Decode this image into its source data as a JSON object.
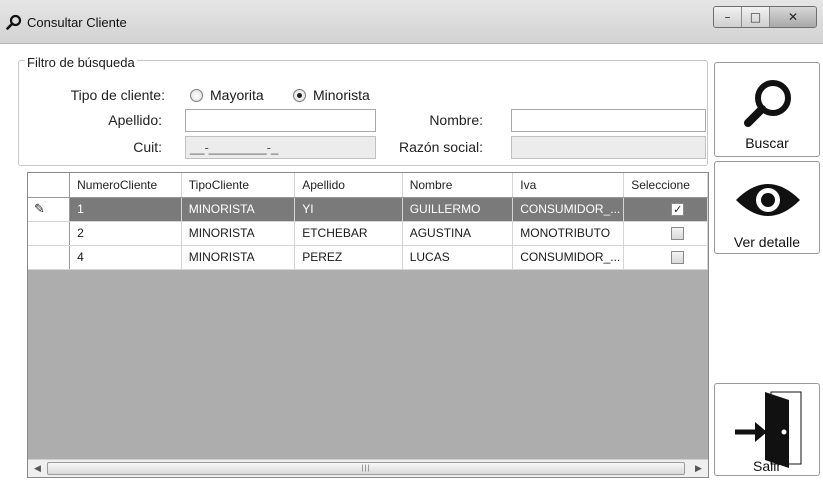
{
  "window": {
    "title": "Consultar Cliente",
    "minimize_glyph": "–",
    "maximize_glyph": "□",
    "close_glyph": "✕"
  },
  "filter": {
    "legend": "Filtro de búsqueda",
    "tipo_label": "Tipo de cliente:",
    "radio_mayorista": "Mayorita",
    "radio_minorista": "Minorista",
    "selected_type": "Minorista",
    "apellido_label": "Apellido:",
    "apellido_value": "",
    "nombre_label": "Nombre:",
    "nombre_value": "",
    "cuit_label": "Cuit:",
    "cuit_mask": "__-________-_",
    "razon_label": "Razón social:",
    "razon_value": ""
  },
  "grid": {
    "columns": [
      "NumeroCliente",
      "TipoCliente",
      "Apellido",
      "Nombre",
      "Iva",
      "Seleccione"
    ],
    "rows": [
      {
        "numero": "1",
        "tipo": "MINORISTA",
        "apellido": "YI",
        "nombre": "GUILLERMO",
        "iva": "CONSUMIDOR_...",
        "checked": true
      },
      {
        "numero": "2",
        "tipo": "MINORISTA",
        "apellido": "ETCHEBAR",
        "nombre": "AGUSTINA",
        "iva": "MONOTRIBUTO",
        "checked": false
      },
      {
        "numero": "4",
        "tipo": "MINORISTA",
        "apellido": "PEREZ",
        "nombre": "LUCAS",
        "iva": "CONSUMIDOR_...",
        "checked": false
      }
    ],
    "edit_glyph": "✎",
    "check_glyph": "✓",
    "scroll_left": "◀",
    "scroll_right": "▶",
    "scroll_grip": "|||"
  },
  "buttons": {
    "buscar_label": "Buscar",
    "ver_detalle_label": "Ver detalle",
    "salir_label": "Salir"
  },
  "icons": {
    "title_icon": "search-icon",
    "buscar_icon": "magnifier-icon",
    "ver_icon": "eye-icon",
    "salir_icon": "exit-door-icon"
  }
}
